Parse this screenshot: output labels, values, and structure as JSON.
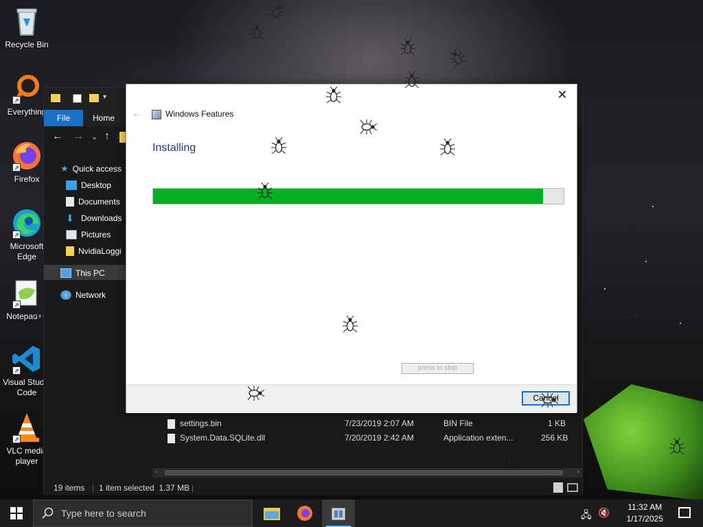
{
  "desktop": {
    "icons": [
      {
        "label": "Recycle Bin"
      },
      {
        "label": "Everything"
      },
      {
        "label": "Firefox"
      },
      {
        "label": "Microsoft Edge"
      },
      {
        "label": "Notepad++"
      },
      {
        "label": "Visual Studio Code"
      },
      {
        "label": "VLC media player"
      }
    ]
  },
  "explorer": {
    "tabs": {
      "file": "File",
      "home": "Home"
    },
    "sidebar": [
      {
        "label": "Quick access"
      },
      {
        "label": "Desktop"
      },
      {
        "label": "Documents"
      },
      {
        "label": "Downloads"
      },
      {
        "label": "Pictures"
      },
      {
        "label": "NvidiaLoggi"
      },
      {
        "label": "This PC"
      },
      {
        "label": "Network"
      }
    ],
    "files": [
      {
        "name": "settings.bin",
        "date": "7/23/2019 2:07 AM",
        "type": "BIN File",
        "size": "1 KB"
      },
      {
        "name": "System.Data.SQLite.dll",
        "date": "7/20/2019 2:42 AM",
        "type": "Application exten...",
        "size": "256 KB"
      }
    ],
    "status": {
      "items": "19 items",
      "selected": "1 item selected  1.37 MB"
    }
  },
  "dialog": {
    "title": "Windows Features",
    "heading": "Installing",
    "progress": 0.95,
    "stop_label": "press to stop",
    "cancel_label": "Cancel"
  },
  "taskbar": {
    "search_placeholder": "Type here to search",
    "time": "11:32 AM",
    "date": "1/17/2025"
  },
  "colors": {
    "progress_fill": "#06b025",
    "file_tab": "#1a6fc4",
    "heading": "#1e3f7a"
  }
}
